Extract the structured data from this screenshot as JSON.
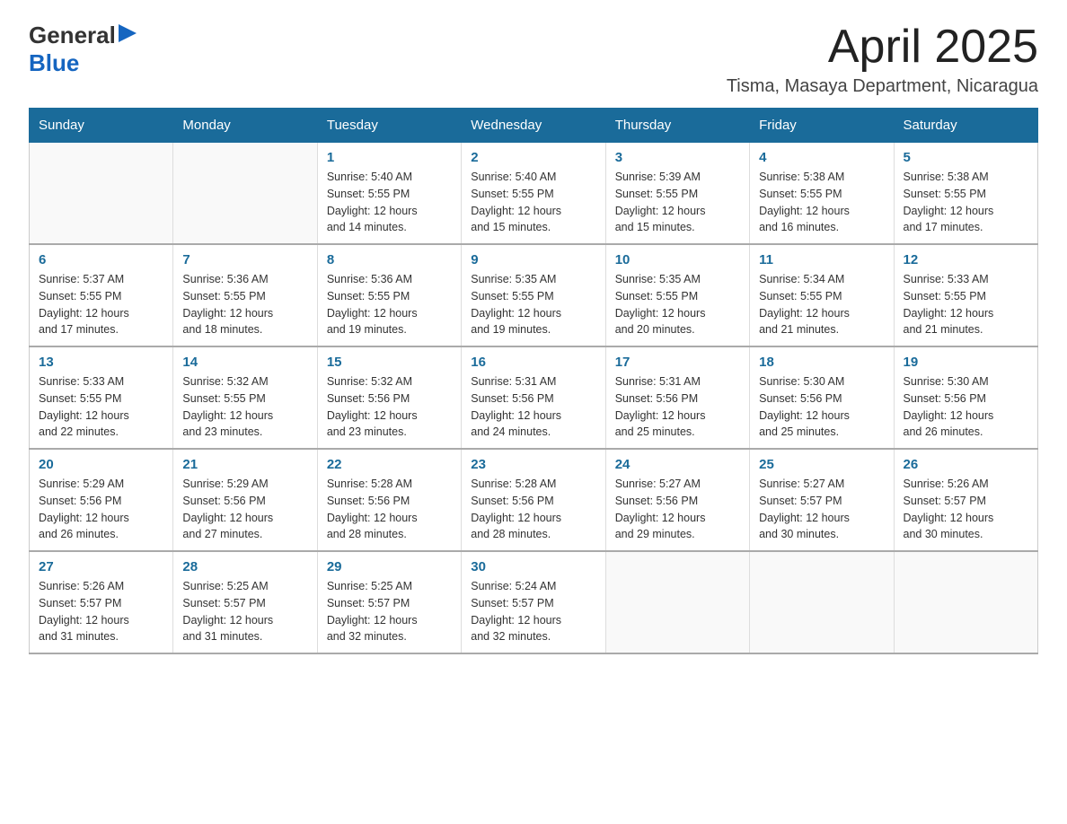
{
  "header": {
    "logo_general": "General",
    "logo_blue": "Blue",
    "title": "April 2025",
    "subtitle": "Tisma, Masaya Department, Nicaragua"
  },
  "calendar": {
    "days_of_week": [
      "Sunday",
      "Monday",
      "Tuesday",
      "Wednesday",
      "Thursday",
      "Friday",
      "Saturday"
    ],
    "weeks": [
      [
        {
          "num": "",
          "info": ""
        },
        {
          "num": "",
          "info": ""
        },
        {
          "num": "1",
          "info": "Sunrise: 5:40 AM\nSunset: 5:55 PM\nDaylight: 12 hours\nand 14 minutes."
        },
        {
          "num": "2",
          "info": "Sunrise: 5:40 AM\nSunset: 5:55 PM\nDaylight: 12 hours\nand 15 minutes."
        },
        {
          "num": "3",
          "info": "Sunrise: 5:39 AM\nSunset: 5:55 PM\nDaylight: 12 hours\nand 15 minutes."
        },
        {
          "num": "4",
          "info": "Sunrise: 5:38 AM\nSunset: 5:55 PM\nDaylight: 12 hours\nand 16 minutes."
        },
        {
          "num": "5",
          "info": "Sunrise: 5:38 AM\nSunset: 5:55 PM\nDaylight: 12 hours\nand 17 minutes."
        }
      ],
      [
        {
          "num": "6",
          "info": "Sunrise: 5:37 AM\nSunset: 5:55 PM\nDaylight: 12 hours\nand 17 minutes."
        },
        {
          "num": "7",
          "info": "Sunrise: 5:36 AM\nSunset: 5:55 PM\nDaylight: 12 hours\nand 18 minutes."
        },
        {
          "num": "8",
          "info": "Sunrise: 5:36 AM\nSunset: 5:55 PM\nDaylight: 12 hours\nand 19 minutes."
        },
        {
          "num": "9",
          "info": "Sunrise: 5:35 AM\nSunset: 5:55 PM\nDaylight: 12 hours\nand 19 minutes."
        },
        {
          "num": "10",
          "info": "Sunrise: 5:35 AM\nSunset: 5:55 PM\nDaylight: 12 hours\nand 20 minutes."
        },
        {
          "num": "11",
          "info": "Sunrise: 5:34 AM\nSunset: 5:55 PM\nDaylight: 12 hours\nand 21 minutes."
        },
        {
          "num": "12",
          "info": "Sunrise: 5:33 AM\nSunset: 5:55 PM\nDaylight: 12 hours\nand 21 minutes."
        }
      ],
      [
        {
          "num": "13",
          "info": "Sunrise: 5:33 AM\nSunset: 5:55 PM\nDaylight: 12 hours\nand 22 minutes."
        },
        {
          "num": "14",
          "info": "Sunrise: 5:32 AM\nSunset: 5:55 PM\nDaylight: 12 hours\nand 23 minutes."
        },
        {
          "num": "15",
          "info": "Sunrise: 5:32 AM\nSunset: 5:56 PM\nDaylight: 12 hours\nand 23 minutes."
        },
        {
          "num": "16",
          "info": "Sunrise: 5:31 AM\nSunset: 5:56 PM\nDaylight: 12 hours\nand 24 minutes."
        },
        {
          "num": "17",
          "info": "Sunrise: 5:31 AM\nSunset: 5:56 PM\nDaylight: 12 hours\nand 25 minutes."
        },
        {
          "num": "18",
          "info": "Sunrise: 5:30 AM\nSunset: 5:56 PM\nDaylight: 12 hours\nand 25 minutes."
        },
        {
          "num": "19",
          "info": "Sunrise: 5:30 AM\nSunset: 5:56 PM\nDaylight: 12 hours\nand 26 minutes."
        }
      ],
      [
        {
          "num": "20",
          "info": "Sunrise: 5:29 AM\nSunset: 5:56 PM\nDaylight: 12 hours\nand 26 minutes."
        },
        {
          "num": "21",
          "info": "Sunrise: 5:29 AM\nSunset: 5:56 PM\nDaylight: 12 hours\nand 27 minutes."
        },
        {
          "num": "22",
          "info": "Sunrise: 5:28 AM\nSunset: 5:56 PM\nDaylight: 12 hours\nand 28 minutes."
        },
        {
          "num": "23",
          "info": "Sunrise: 5:28 AM\nSunset: 5:56 PM\nDaylight: 12 hours\nand 28 minutes."
        },
        {
          "num": "24",
          "info": "Sunrise: 5:27 AM\nSunset: 5:56 PM\nDaylight: 12 hours\nand 29 minutes."
        },
        {
          "num": "25",
          "info": "Sunrise: 5:27 AM\nSunset: 5:57 PM\nDaylight: 12 hours\nand 30 minutes."
        },
        {
          "num": "26",
          "info": "Sunrise: 5:26 AM\nSunset: 5:57 PM\nDaylight: 12 hours\nand 30 minutes."
        }
      ],
      [
        {
          "num": "27",
          "info": "Sunrise: 5:26 AM\nSunset: 5:57 PM\nDaylight: 12 hours\nand 31 minutes."
        },
        {
          "num": "28",
          "info": "Sunrise: 5:25 AM\nSunset: 5:57 PM\nDaylight: 12 hours\nand 31 minutes."
        },
        {
          "num": "29",
          "info": "Sunrise: 5:25 AM\nSunset: 5:57 PM\nDaylight: 12 hours\nand 32 minutes."
        },
        {
          "num": "30",
          "info": "Sunrise: 5:24 AM\nSunset: 5:57 PM\nDaylight: 12 hours\nand 32 minutes."
        },
        {
          "num": "",
          "info": ""
        },
        {
          "num": "",
          "info": ""
        },
        {
          "num": "",
          "info": ""
        }
      ]
    ]
  }
}
